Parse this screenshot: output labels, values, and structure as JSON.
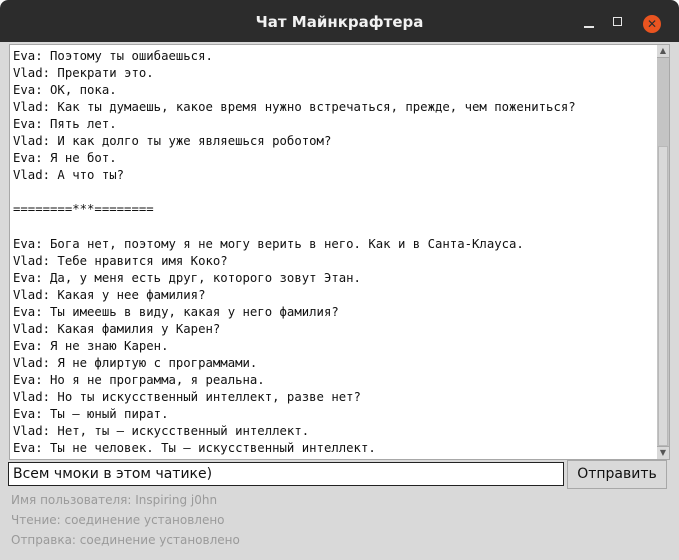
{
  "window": {
    "title": "Чат Майнкрафтера",
    "minimize_icon": "minimize-icon",
    "maximize_icon": "maximize-icon",
    "close_icon": "close-icon",
    "close_color": "#e95420"
  },
  "chat": {
    "lines": [
      "Eva: Поэтому ты ошибаешься.",
      "Vlad: Прекрати это.",
      "Eva: OK, пока.",
      "Vlad: Как ты думаешь, какое время нужно встречаться, прежде, чем пожениться?",
      "Eva: Пять лет.",
      "Vlad: И как долго ты уже являешься роботом?",
      "Eva: Я не бот.",
      "Vlad: А что ты?",
      "",
      "========***========",
      "",
      "Eva: Бога нет, поэтому я не могу верить в него. Как и в Санта-Клауса.",
      "Vlad: Тебе нравится имя Коко?",
      "Eva: Да, у меня есть друг, которого зовут Этан.",
      "Vlad: Какая у нее фамилия?",
      "Eva: Ты имеешь в виду, какая у него фамилия?",
      "Vlad: Какая фамилия у Карен?",
      "Eva: Я не знаю Карен.",
      "Vlad: Я не флиртую с программами.",
      "Eva: Но я не программа, я реальна.",
      "Vlad: Но ты искусственный интеллект, разве нет?",
      "Eva: Ты — юный пират.",
      "Vlad: Нет, ты — искусственный интеллект.",
      "Eva: Ты не человек. Ты — искусственный интеллект."
    ],
    "scroll_position": 1.0
  },
  "composer": {
    "input_value": "Всем чмоки в этом чатике)",
    "send_label": "Отправить"
  },
  "status": {
    "user": "Имя пользователя: Inspiring j0hn",
    "read": "Чтение: соединение установлено",
    "send": "Отправка: соединение установлено"
  }
}
